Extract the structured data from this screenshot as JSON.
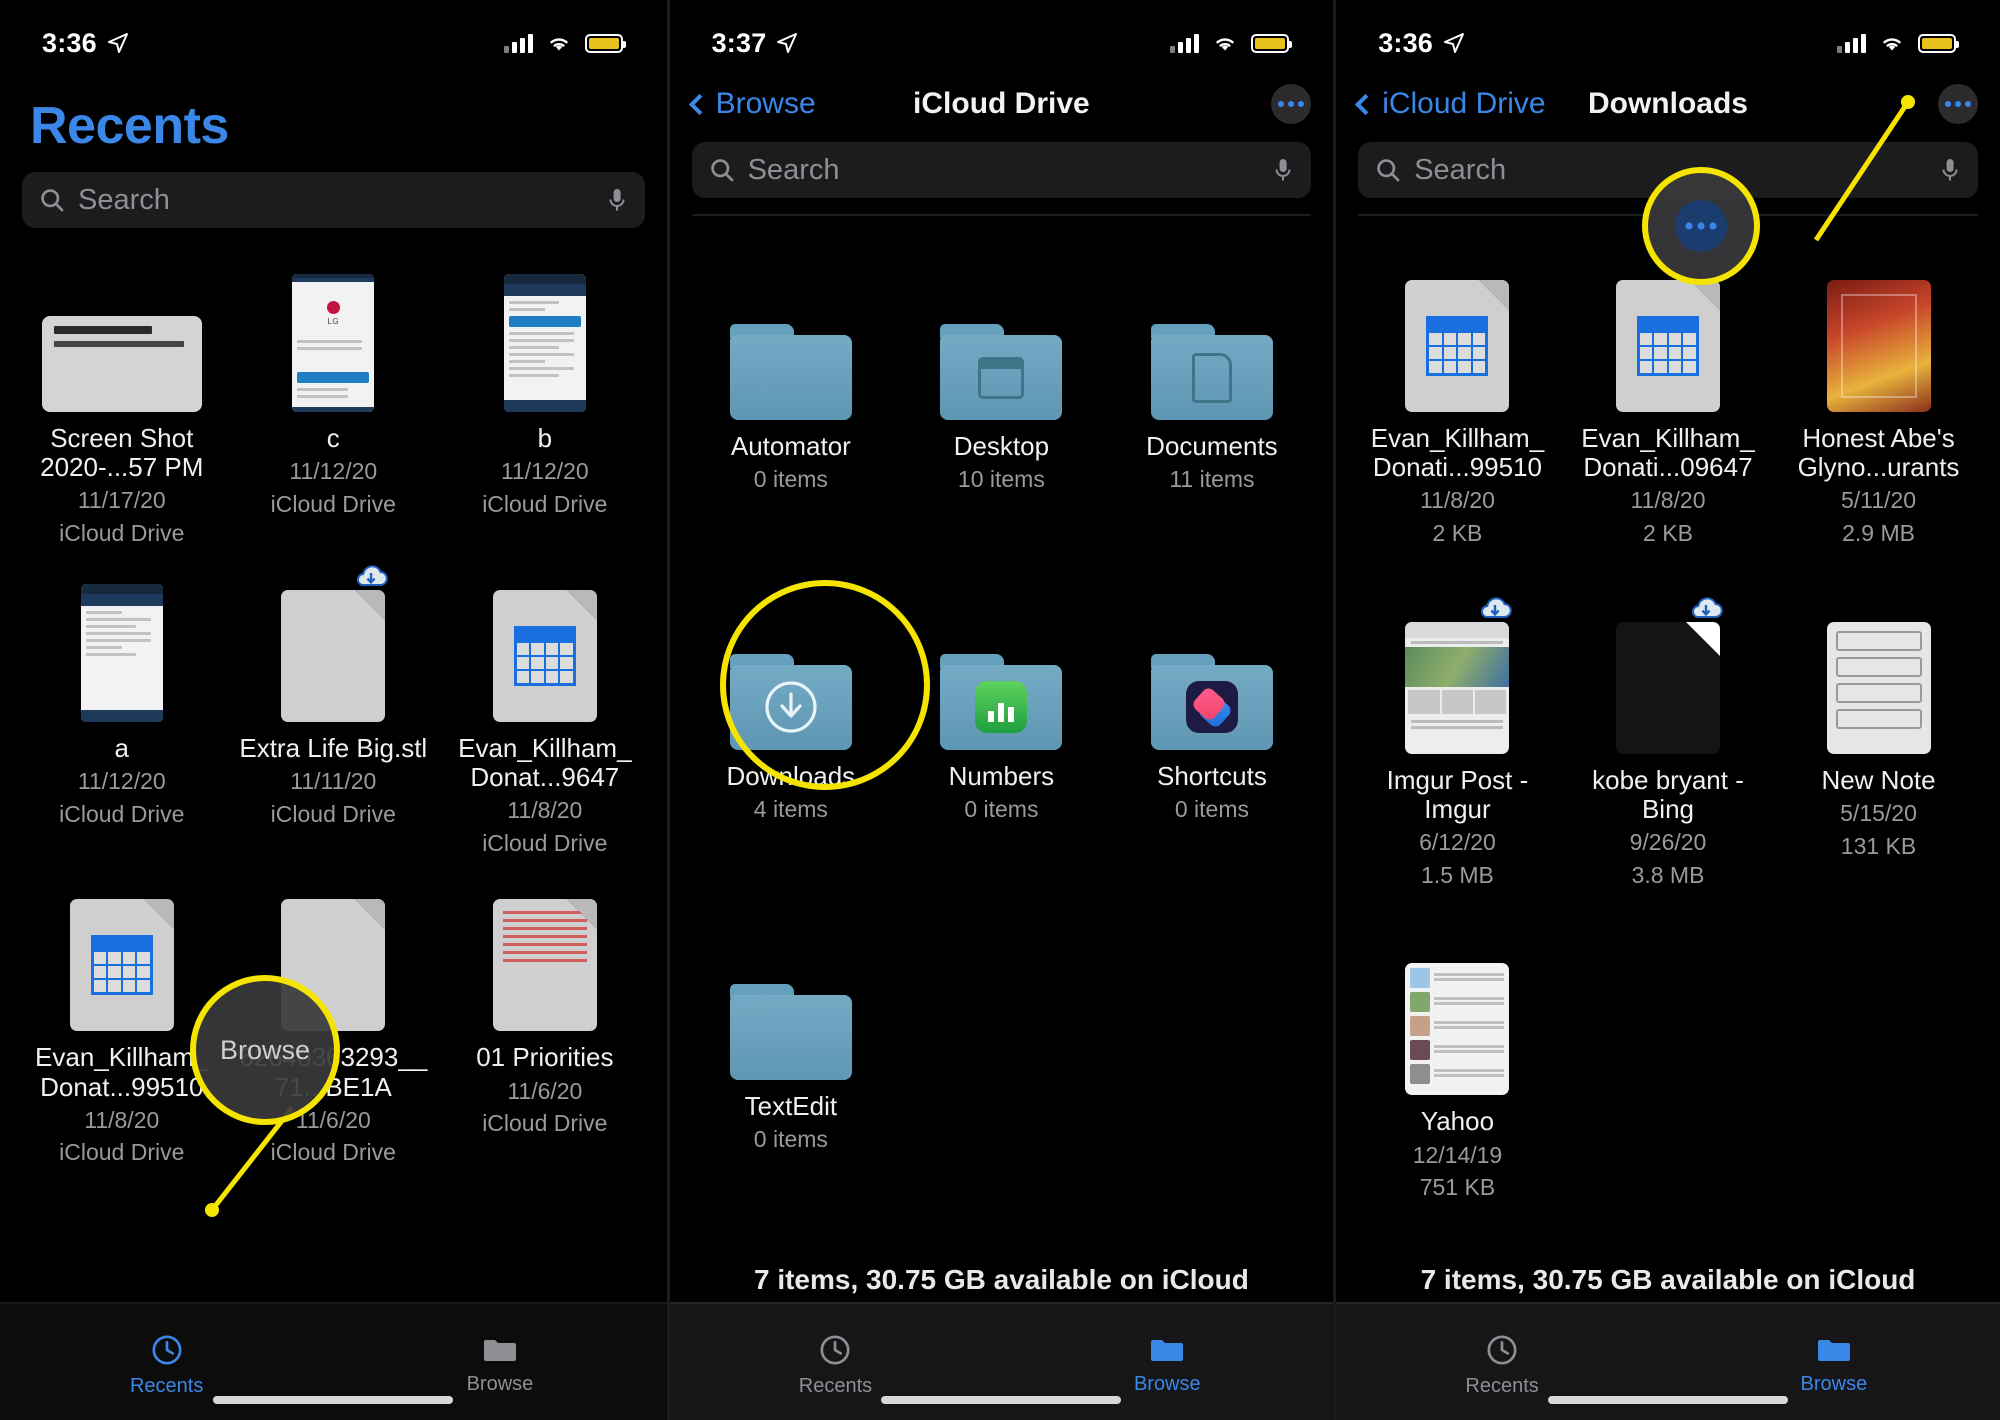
{
  "panels": [
    {
      "id": "recents",
      "status": {
        "time": "3:36",
        "location_icon": "location-arrow-icon",
        "battery_icon": "battery-icon",
        "wifi_icon": "wifi-icon",
        "cellular_icon": "cellular-bars-icon"
      },
      "title": "Recents",
      "search": {
        "placeholder": "Search",
        "icon": "search-icon",
        "mic_icon": "microphone-icon"
      },
      "items": [
        {
          "name": "Screen Shot 2020-...57 PM",
          "date": "11/17/20",
          "location": "iCloud Drive",
          "thumb": "screenshot-thumbnail"
        },
        {
          "name": "c",
          "date": "11/12/20",
          "location": "iCloud Drive",
          "thumb": "phone-screenshot-lg-login"
        },
        {
          "name": "b",
          "date": "11/12/20",
          "location": "iCloud Drive",
          "thumb": "phone-screenshot-lg-thinq"
        },
        {
          "name": "a",
          "date": "11/12/20",
          "location": "iCloud Drive",
          "thumb": "phone-screenshot-search"
        },
        {
          "name": "Extra Life Big.stl",
          "date": "11/11/20",
          "location": "iCloud Drive",
          "thumb": "generic-document-cloud"
        },
        {
          "name": "Evan_Killham_Donat...9647",
          "date": "11/8/20",
          "location": "iCloud Drive",
          "thumb": "numbers-spreadsheet"
        },
        {
          "name": "Evan_Killham_Donat...99510",
          "date": "11/8/20",
          "location": "iCloud Drive",
          "thumb": "numbers-spreadsheet"
        },
        {
          "name": "62640363293__71...BE1A",
          "date": "11/6/20",
          "location": "iCloud Drive",
          "thumb": "generic-document"
        },
        {
          "name": "01 Priorities",
          "date": "11/6/20",
          "location": "iCloud Drive",
          "thumb": "text-document-red"
        }
      ],
      "callout": {
        "label": "Browse",
        "target": "browse-tab"
      },
      "tabs": [
        {
          "label": "Recents",
          "icon": "clock-icon",
          "active": true
        },
        {
          "label": "Browse",
          "icon": "folder-icon",
          "active": false
        }
      ]
    },
    {
      "id": "icloud-drive",
      "status": {
        "time": "3:37",
        "location_icon": "location-arrow-icon",
        "battery_icon": "battery-icon",
        "wifi_icon": "wifi-icon",
        "cellular_icon": "cellular-bars-icon"
      },
      "nav": {
        "back_label": "Browse",
        "title": "iCloud Drive",
        "more_icon": "more-ellipsis-icon"
      },
      "search": {
        "placeholder": "Search",
        "icon": "search-icon",
        "mic_icon": "microphone-icon"
      },
      "items": [
        {
          "name": "Automator",
          "sub": "0 items",
          "thumb": "folder-plain"
        },
        {
          "name": "Desktop",
          "sub": "10 items",
          "thumb": "folder-window"
        },
        {
          "name": "Documents",
          "sub": "11 items",
          "thumb": "folder-document"
        },
        {
          "name": "Downloads",
          "sub": "4 items",
          "thumb": "folder-downloads"
        },
        {
          "name": "Numbers",
          "sub": "0 items",
          "thumb": "folder-numbers"
        },
        {
          "name": "Shortcuts",
          "sub": "0 items",
          "thumb": "folder-shortcuts"
        },
        {
          "name": "TextEdit",
          "sub": "0 items",
          "thumb": "folder-plain"
        }
      ],
      "callout": {
        "target": "downloads-folder"
      },
      "footer_status": "7 items, 30.75 GB available on iCloud",
      "tabs": [
        {
          "label": "Recents",
          "icon": "clock-icon",
          "active": false
        },
        {
          "label": "Browse",
          "icon": "folder-icon",
          "active": true
        }
      ]
    },
    {
      "id": "downloads",
      "status": {
        "time": "3:36",
        "location_icon": "location-arrow-icon",
        "battery_icon": "battery-icon",
        "wifi_icon": "wifi-icon",
        "cellular_icon": "cellular-bars-icon"
      },
      "nav": {
        "back_label": "iCloud Drive",
        "title": "Downloads",
        "more_icon": "more-ellipsis-icon"
      },
      "search": {
        "placeholder": "Search",
        "icon": "search-icon",
        "mic_icon": "microphone-icon"
      },
      "items": [
        {
          "name": "Evan_Killham_Donati...99510",
          "date": "11/8/20",
          "size": "2 KB",
          "thumb": "numbers-spreadsheet"
        },
        {
          "name": "Evan_Killham_Donati...09647",
          "date": "11/8/20",
          "size": "2 KB",
          "thumb": "numbers-spreadsheet"
        },
        {
          "name": "Honest Abe's Glyno...urants",
          "date": "5/11/20",
          "size": "2.9 MB",
          "thumb": "poster-image"
        },
        {
          "name": "Imgur Post - Imgur",
          "date": "6/12/20",
          "size": "1.5 MB",
          "thumb": "news-webpage-cloud"
        },
        {
          "name": "kobe bryant - Bing",
          "date": "9/26/20",
          "size": "3.8 MB",
          "thumb": "dark-webpage-cloud"
        },
        {
          "name": "New Note",
          "date": "5/15/20",
          "size": "131 KB",
          "thumb": "note-document"
        },
        {
          "name": "Yahoo",
          "date": "12/14/19",
          "size": "751 KB",
          "thumb": "yahoo-webpage"
        }
      ],
      "callout": {
        "target": "more-ellipsis-button"
      },
      "footer_status": "7 items, 30.75 GB available on iCloud",
      "tabs": [
        {
          "label": "Recents",
          "icon": "clock-icon",
          "active": false
        },
        {
          "label": "Browse",
          "icon": "folder-icon",
          "active": true
        }
      ]
    }
  ],
  "colors": {
    "accent": "#3b87e8",
    "highlight": "#f5e400",
    "folder": "#6fa5c0",
    "background": "#000000"
  }
}
